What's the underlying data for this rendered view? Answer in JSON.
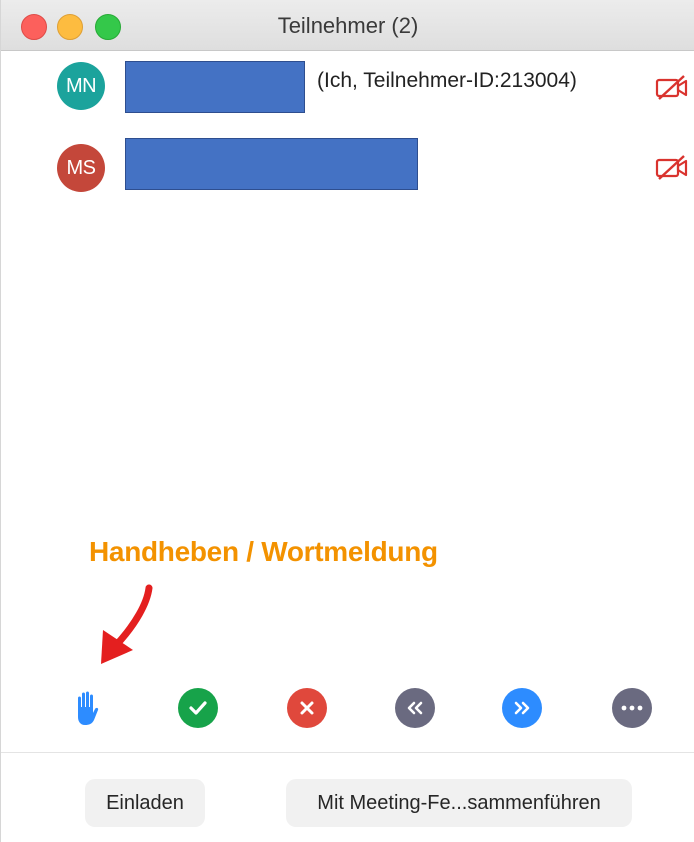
{
  "window": {
    "title": "Teilnehmer (2)"
  },
  "participants": [
    {
      "initials": "MN",
      "avatar_color": "#1ba39c",
      "label": "(Ich, Teilnehmer-ID:213004)",
      "video_status": "camera-off-icon"
    },
    {
      "initials": "MS",
      "avatar_color": "#c4473a",
      "label": "",
      "video_status": "camera-off-icon"
    }
  ],
  "annotation": {
    "text": "Handheben / Wortmeldung",
    "color": "#f39200",
    "arrow_color": "#e41f1f"
  },
  "reactions": [
    {
      "name": "raise-hand",
      "icon": "raise-hand-icon",
      "color": "#2d8cff"
    },
    {
      "name": "yes",
      "icon": "checkmark-icon",
      "color": "#17a34a"
    },
    {
      "name": "no",
      "icon": "x-icon",
      "color": "#e0483c"
    },
    {
      "name": "go-slower",
      "icon": "double-chevron-left-icon",
      "color": "#6a6a80"
    },
    {
      "name": "go-faster",
      "icon": "double-chevron-right-icon",
      "color": "#2d8cff"
    },
    {
      "name": "more",
      "icon": "ellipsis-icon",
      "color": "#6a6a80"
    }
  ],
  "footer": {
    "invite_label": "Einladen",
    "merge_label": "Mit Meeting-Fe...sammenführen"
  }
}
